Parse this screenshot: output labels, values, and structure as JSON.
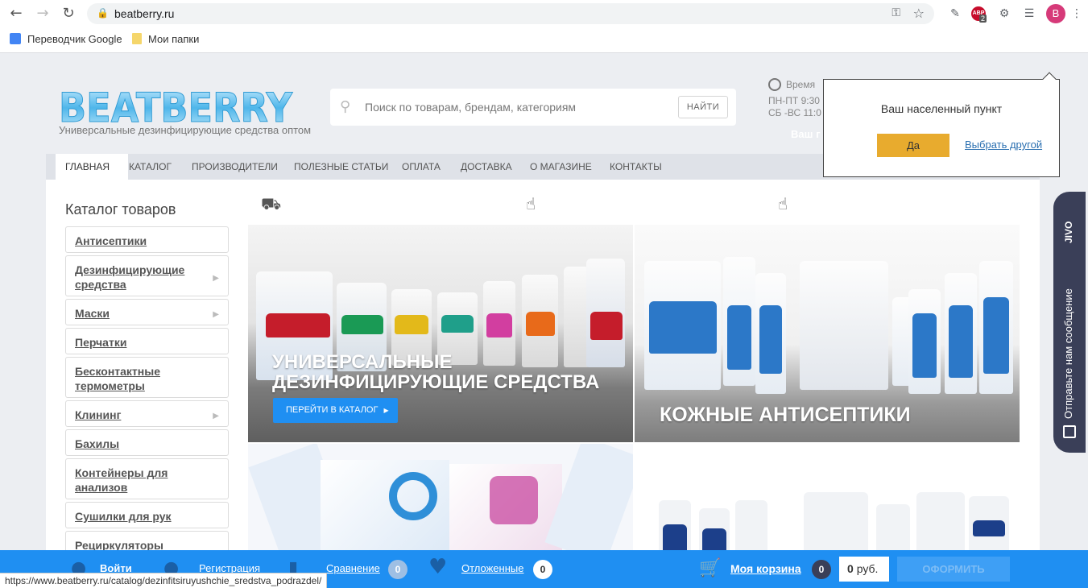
{
  "browser": {
    "url": "beatberry.ru",
    "profile_initial": "B",
    "abp_label": "ABP",
    "abp_count": "2",
    "bookmarks": [
      {
        "label": "Переводчик Google"
      },
      {
        "label": "Мои папки"
      }
    ]
  },
  "header": {
    "logo_text": "BEATBERRY",
    "tagline": "Универсальные дезинфицирующие средства оптом",
    "search_placeholder": "Поиск по товарам, брендам, категориям",
    "search_button": "НАЙТИ",
    "hours_label": "Время",
    "hours_weekdays": "ПН-ПТ  9:30",
    "hours_weekend": "СБ -ВС  11:0",
    "city_hidden": "Ваш г"
  },
  "nav": {
    "items": [
      "ГЛАВНАЯ",
      "КАТАЛОГ",
      "ПРОИЗВОДИТЕЛИ",
      "ПОЛЕЗНЫЕ СТАТЬИ",
      "ОПЛАТА",
      "ДОСТАВКА",
      "О МАГАЗИНЕ",
      "КОНТАКТЫ"
    ]
  },
  "sidebar": {
    "title": "Каталог товаров",
    "items": [
      {
        "label": "Антисептики",
        "has_sub": false
      },
      {
        "label": "Дезинфицирующие средства",
        "has_sub": true
      },
      {
        "label": "Маски",
        "has_sub": true
      },
      {
        "label": "Перчатки",
        "has_sub": false
      },
      {
        "label": "Бесконтактные термометры",
        "has_sub": false
      },
      {
        "label": "Клининг",
        "has_sub": true
      },
      {
        "label": "Бахилы",
        "has_sub": false
      },
      {
        "label": "Контейнеры для анализов",
        "has_sub": false
      },
      {
        "label": "Сушилки для рук",
        "has_sub": false
      },
      {
        "label": "Рециркуляторы",
        "has_sub": false
      }
    ]
  },
  "banners": {
    "first_title_line1": "УНИВЕРСАЛЬНЫЕ",
    "first_title_line2": "ДЕЗИНФИЦИРУЮЩИЕ СРЕДСТВА",
    "first_button": "ПЕРЕЙТИ В КАТАЛОГ",
    "second_title": "КОЖНЫЕ АНТИСЕПТИКИ"
  },
  "city_popup": {
    "question": "Ваш населенный пункт",
    "yes": "Да",
    "other": "Выбрать другой"
  },
  "jivo": {
    "brand": "JIVO",
    "message": "Отправьте нам сообщение"
  },
  "bottom_bar": {
    "login": "Войти",
    "register": "Регистрация",
    "compare": "Сравнение",
    "compare_count": "0",
    "deferred": "Отложенные",
    "deferred_count": "0",
    "cart": "Моя корзина",
    "cart_count": "0",
    "price_value": "0",
    "price_unit": "руб.",
    "checkout": "ОФОРМИТЬ"
  },
  "status_url": "https://www.beatberry.ru/catalog/dezinfitsiruyushchie_sredstva_podrazdel/"
}
